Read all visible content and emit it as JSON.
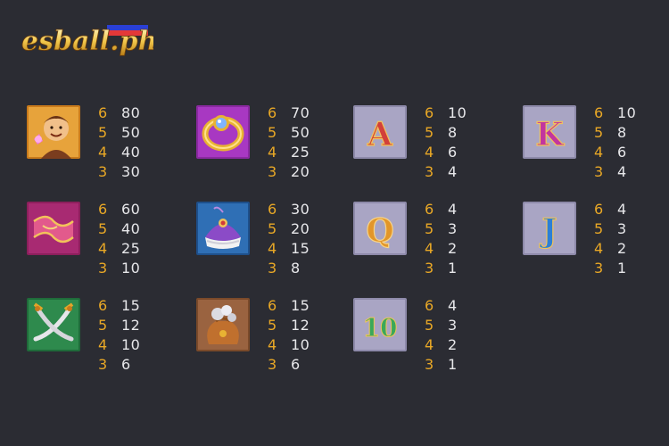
{
  "brand": {
    "logo_text": "esball.ph"
  },
  "symbols": [
    {
      "id": "aladdin",
      "icon": "aladdin-icon",
      "pays": [
        [
          "6",
          "80"
        ],
        [
          "5",
          "50"
        ],
        [
          "4",
          "40"
        ],
        [
          "3",
          "30"
        ]
      ]
    },
    {
      "id": "ring",
      "icon": "ring-icon",
      "pays": [
        [
          "6",
          "70"
        ],
        [
          "5",
          "50"
        ],
        [
          "4",
          "25"
        ],
        [
          "3",
          "20"
        ]
      ]
    },
    {
      "id": "a",
      "icon": "letter-a-icon",
      "pays": [
        [
          "6",
          "10"
        ],
        [
          "5",
          "8"
        ],
        [
          "4",
          "6"
        ],
        [
          "3",
          "4"
        ]
      ]
    },
    {
      "id": "k",
      "icon": "letter-k-icon",
      "pays": [
        [
          "6",
          "10"
        ],
        [
          "5",
          "8"
        ],
        [
          "4",
          "6"
        ],
        [
          "3",
          "4"
        ]
      ]
    },
    {
      "id": "carpet",
      "icon": "magic-carpet-icon",
      "pays": [
        [
          "6",
          "60"
        ],
        [
          "5",
          "40"
        ],
        [
          "4",
          "25"
        ],
        [
          "3",
          "10"
        ]
      ]
    },
    {
      "id": "turban",
      "icon": "turban-icon",
      "pays": [
        [
          "6",
          "30"
        ],
        [
          "5",
          "20"
        ],
        [
          "4",
          "15"
        ],
        [
          "3",
          "8"
        ]
      ]
    },
    {
      "id": "q",
      "icon": "letter-q-icon",
      "pays": [
        [
          "6",
          "4"
        ],
        [
          "5",
          "3"
        ],
        [
          "4",
          "2"
        ],
        [
          "3",
          "1"
        ]
      ]
    },
    {
      "id": "j",
      "icon": "letter-j-icon",
      "pays": [
        [
          "6",
          "4"
        ],
        [
          "5",
          "3"
        ],
        [
          "4",
          "2"
        ],
        [
          "3",
          "1"
        ]
      ]
    },
    {
      "id": "swords",
      "icon": "crossed-swords-icon",
      "pays": [
        [
          "6",
          "15"
        ],
        [
          "5",
          "12"
        ],
        [
          "4",
          "10"
        ],
        [
          "3",
          "6"
        ]
      ]
    },
    {
      "id": "coinbag",
      "icon": "coin-bag-icon",
      "pays": [
        [
          "6",
          "15"
        ],
        [
          "5",
          "12"
        ],
        [
          "4",
          "10"
        ],
        [
          "3",
          "6"
        ]
      ]
    },
    {
      "id": "ten",
      "icon": "number-10-icon",
      "pays": [
        [
          "6",
          "4"
        ],
        [
          "5",
          "3"
        ],
        [
          "4",
          "2"
        ],
        [
          "3",
          "1"
        ]
      ]
    }
  ],
  "colors": {
    "background": "#2b2c33",
    "count": "#e9a826",
    "payout": "#e7e7ea"
  }
}
